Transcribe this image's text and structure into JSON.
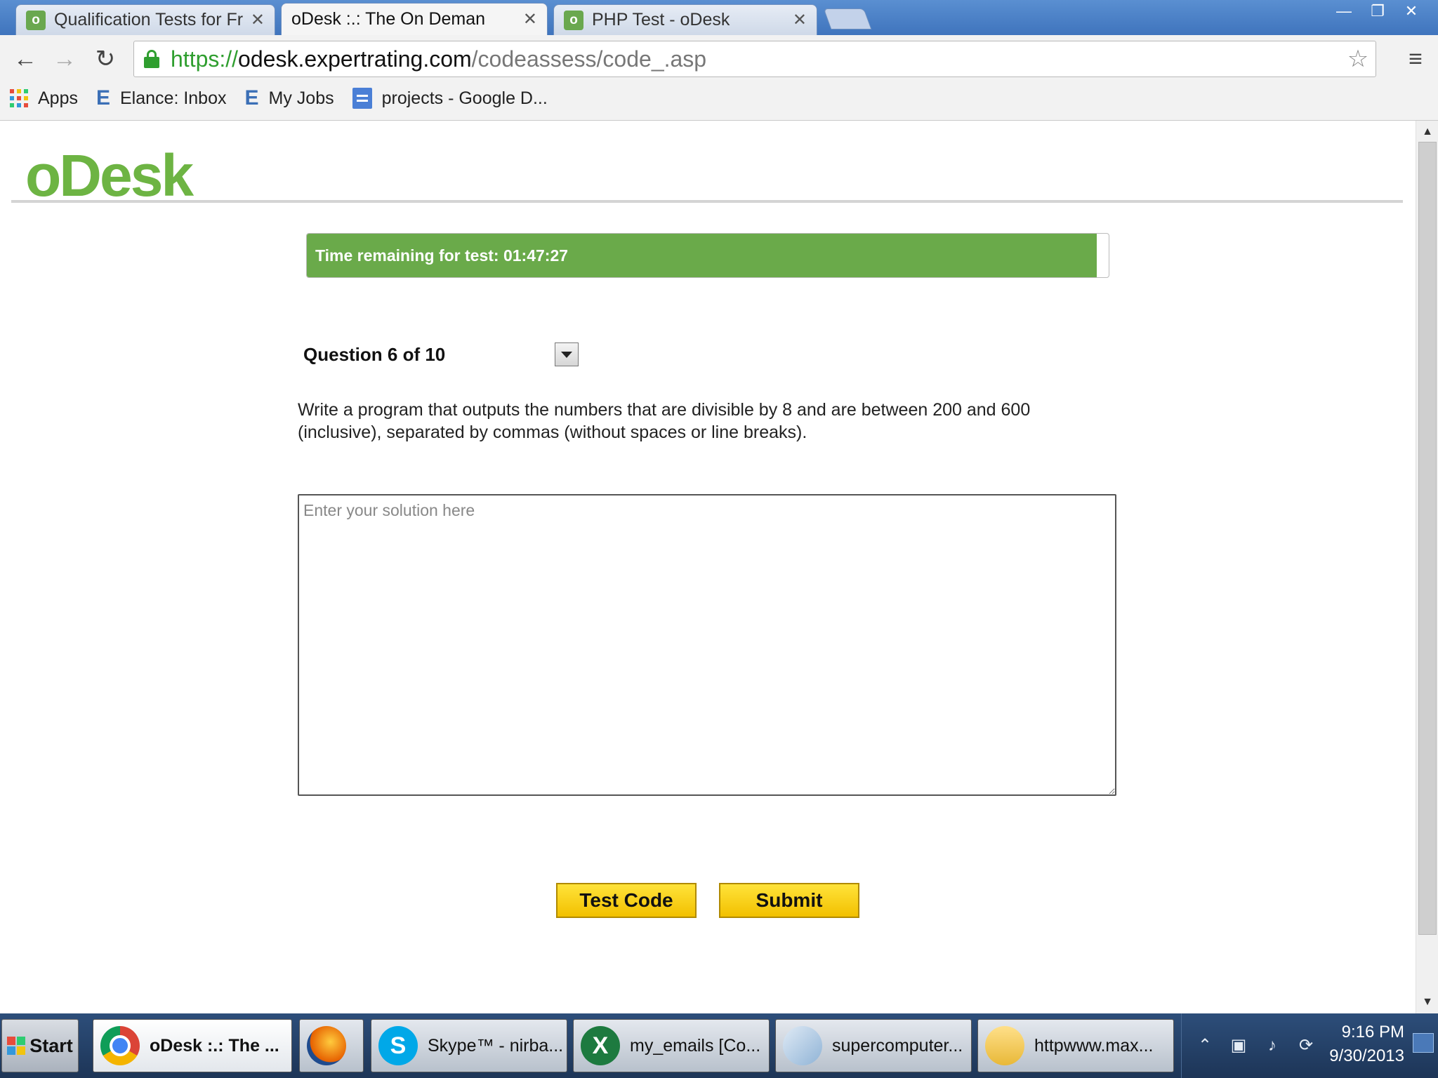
{
  "browser": {
    "tabs": [
      {
        "label": "Qualification Tests for Fre",
        "favicon": "odesk-icon",
        "active": false
      },
      {
        "label": "oDesk :.: The On Deman",
        "favicon": "page-icon",
        "active": true
      },
      {
        "label": "PHP Test - oDesk",
        "favicon": "odesk-icon",
        "active": false
      }
    ],
    "url": {
      "protocol": "https://",
      "host": "odesk.expertrating.com",
      "path": "/codeassess/code_.asp"
    },
    "bookmarks": [
      {
        "label": "Apps",
        "icon": "apps-grid-icon"
      },
      {
        "label": "Elance: Inbox",
        "icon": "elance-icon"
      },
      {
        "label": "My Jobs",
        "icon": "elance-icon"
      },
      {
        "label": "projects - Google D...",
        "icon": "google-docs-icon"
      }
    ]
  },
  "page": {
    "logo": "oDesk",
    "timer": {
      "label": "Time remaining for test: 01:47:27",
      "progress_fraction": 0.985
    },
    "question": {
      "header": "Question 6 of 10",
      "text": "Write a program that outputs the numbers that are divisible by 8 and are between 200 and 600 (inclusive), separated by commas (without spaces or line breaks)."
    },
    "answer": {
      "placeholder": "Enter your solution here",
      "value": ""
    },
    "buttons": {
      "test_code": "Test Code",
      "submit": "Submit"
    }
  },
  "taskbar": {
    "start": "Start",
    "items": [
      {
        "label": "oDesk :.: The ...",
        "icon": "chrome-icon",
        "active": true
      },
      {
        "label": "",
        "icon": "firefox-icon",
        "active": false
      },
      {
        "label": "Skype™ - nirba...",
        "icon": "skype-icon",
        "active": false
      },
      {
        "label": "my_emails  [Co...",
        "icon": "excel-icon",
        "active": false
      },
      {
        "label": "supercomputer...",
        "icon": "file-icon",
        "active": false
      },
      {
        "label": "httpwww.max...",
        "icon": "folder-icon",
        "active": false
      }
    ],
    "clock": {
      "time": "9:16 PM",
      "date": "9/30/2013"
    }
  },
  "colors": {
    "brand_green": "#6db443",
    "timer_green": "#6aaa4a",
    "button_yellow": "#f7d21c",
    "url_secure_green": "#2f9e2f"
  }
}
